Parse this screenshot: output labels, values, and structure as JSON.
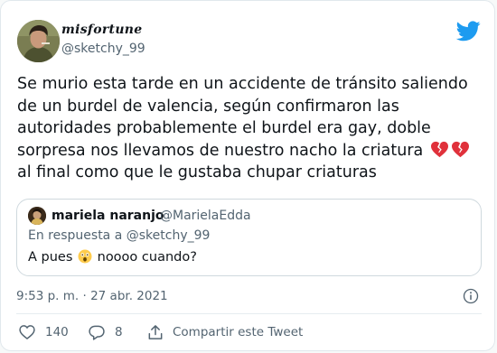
{
  "author": {
    "display_name": "misfortune",
    "handle": "@sketchy_99"
  },
  "tweet": {
    "lines": [
      "Se murio esta tarde en un accidente de tránsito saliendo",
      "de un burdel de valencia, según confirmaron las",
      "autoridades probablemente el burdel era gay, doble",
      "sorpresa nos llevamos de nuestro nacho la criatura",
      "al final como que le gustaba chupar criaturas"
    ],
    "emoji": [
      "broken-heart-emoji",
      "broken-heart-emoji"
    ],
    "timestamp": "9:53 p. m. · 27 abr. 2021"
  },
  "quote": {
    "name": "mariela naranjo",
    "handle": "@MarielaEdda",
    "reply_to": "En respuesta a @sketchy_99",
    "text_before": "A pues",
    "emoji": "astonished-face-emoji",
    "text_after": "noooo cuando?"
  },
  "actions": {
    "likes": "140",
    "replies": "8",
    "share": "Compartir este Tweet"
  },
  "colors": {
    "text_primary": "#0f1419",
    "text_secondary": "#536471",
    "twitter_blue": "#1d9bf0",
    "broken_heart": "#e0313b"
  }
}
